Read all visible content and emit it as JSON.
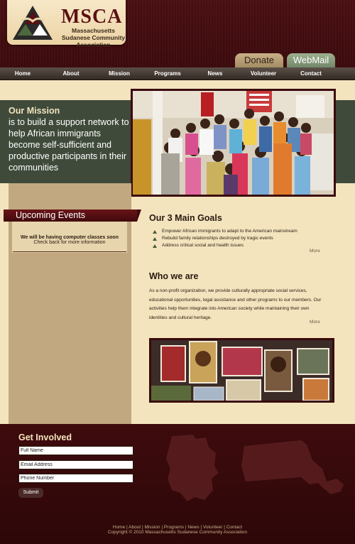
{
  "logo": {
    "acronym": "MSCA",
    "full_name": "Massachusetts Sudanese Community Association"
  },
  "header_buttons": {
    "donate": "Donate",
    "webmail": "WebMail"
  },
  "nav": [
    "Home",
    "About",
    "Mission",
    "Programs",
    "News",
    "Volunteer",
    "Contact"
  ],
  "mission": {
    "title": "Our Mission",
    "text": "is to build a support network to help African immigrants become self-sufficient and productive participants in their communities"
  },
  "events": {
    "title": "Upcoming Events",
    "line1": "We will be having computer classes soon",
    "line2": "Check back for more information"
  },
  "goals": {
    "title": "Our 3 Main Goals",
    "items": [
      "Empower African immigrants to adapt to the American mainstream",
      "Rebuild family relationships destroyed by tragic events",
      "Address critical social and health issues"
    ],
    "more": "More"
  },
  "who": {
    "title": "Who we are",
    "text": "As a non-profit organization, we provide culturally appropriate social services, educational opportunities, legal assistance and other programs to our members. Our activities help them integrate into American society while maintaining their own identities and cultural heritage.",
    "more": "More"
  },
  "get_involved": {
    "title": "Get Involved",
    "fields": [
      "Full Name",
      "Email Address",
      "Phone Number"
    ],
    "submit": "Submit"
  },
  "footer": {
    "links": [
      "Home",
      "About",
      "Mission",
      "Programs",
      "News",
      "Volunteer",
      "Contact"
    ],
    "copyright": "Copyright © 2010 Massachusetts Sudanese Community Association"
  },
  "colors": {
    "maroon": "#3d0a0c",
    "cream": "#f3e4be",
    "olive": "#3f4a3a",
    "tan": "#c1a880"
  }
}
